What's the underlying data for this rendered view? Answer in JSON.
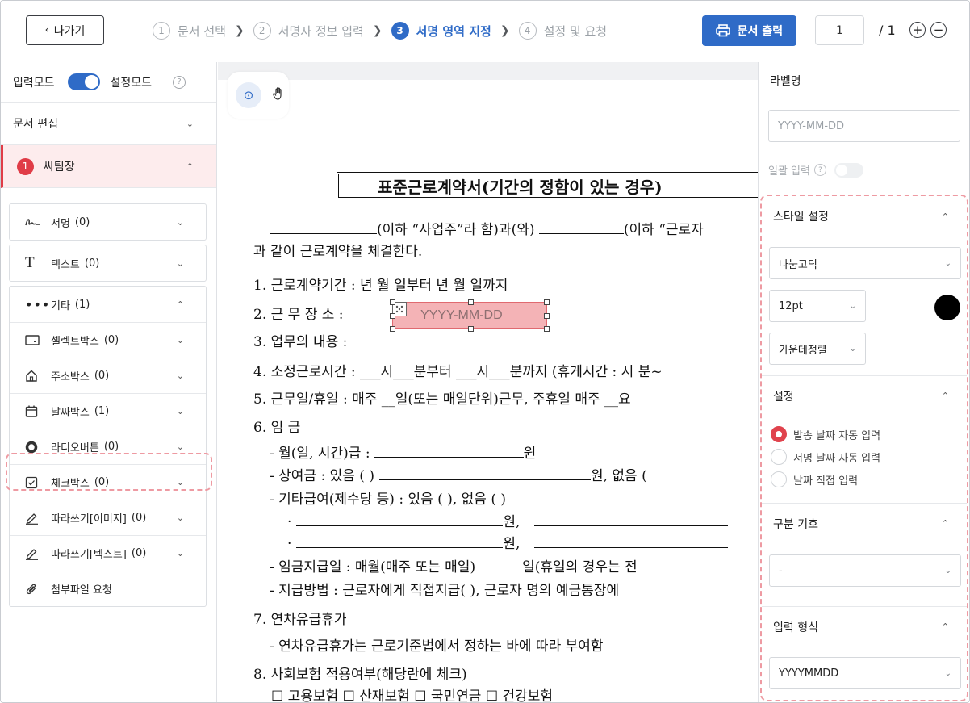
{
  "header": {
    "back_label": "나가기",
    "steps": [
      {
        "num": "1",
        "label": "문서 선택"
      },
      {
        "num": "2",
        "label": "서명자 정보 입력"
      },
      {
        "num": "3",
        "label": "서명 영역 지정",
        "active": true
      },
      {
        "num": "4",
        "label": "설정 및 요청"
      }
    ],
    "print_label": "문서 출력",
    "page_current": "1",
    "page_total": "/ 1"
  },
  "left": {
    "mode_input": "입력모드",
    "mode_setting": "설정모드",
    "help": "?",
    "doc_edit": "문서 편집",
    "participant_num": "1",
    "participant": "싸팀장",
    "fields": {
      "signature": {
        "label": "서명",
        "count": "(0)"
      },
      "text": {
        "label": "텍스트",
        "count": "(0)"
      },
      "other": {
        "label": "기타",
        "count": "(1)"
      },
      "items": [
        {
          "label": "셀렉트박스",
          "count": "(0)",
          "icon": "select-box-icon"
        },
        {
          "label": "주소박스",
          "count": "(0)",
          "icon": "home-icon"
        },
        {
          "label": "날짜박스",
          "count": "(1)",
          "icon": "calendar-icon"
        },
        {
          "label": "라디오버튼",
          "count": "(0)",
          "icon": "radio-icon"
        },
        {
          "label": "체크박스",
          "count": "(0)",
          "icon": "checkbox-icon"
        },
        {
          "label": "따라쓰기[이미지]",
          "count": "(0)",
          "icon": "pen-icon"
        },
        {
          "label": "따라쓰기[텍스트]",
          "count": "(0)",
          "icon": "pen-icon"
        },
        {
          "label": "첨부파일 요청",
          "count": "",
          "icon": "paperclip-icon"
        }
      ]
    }
  },
  "document": {
    "title": "표준근로계약서(기간의 정함이 있는 경우)",
    "lines": [
      "(이하 “사업주”라 함)과(와)",
      "(이하 “근로자",
      "과 같이 근로계약을 체결한다.",
      "1. 근로계약기간 :        년    월    일부터        년    월    일까지",
      "2. 근 무 장 소 :",
      "3. 업무의 내용 :",
      "4. 소정근로시간 : ___시___분부터 ___시___분까지 (휴게시간 :  시  분~",
      "5. 근무일/휴일 : 매주 __일(또는 매일단위)근무, 주휴일 매주 __요",
      "6. 임    금",
      "- 월(일, 시간)급 :",
      "원",
      "- 상여금 : 있음 (      )",
      "원,   없음 (",
      "- 기타급여(제수당 등) : 있음 (      ),     없음 (      )",
      "·",
      "원,",
      "·",
      "원,",
      "- 임금지급일 : 매월(매주 또는 매일)",
      "일(휴일의 경우는 전",
      "- 지급방법 : 근로자에게 직접지급(      ),   근로자 명의 예금통장에",
      "7. 연차유급휴가",
      "- 연차유급휴가는 근로기준법에서 정하는 바에 따라 부여함",
      "8. 사회보험 적용여부(해당란에 체크)",
      "☐ 고용보험  ☐ 산재보험  ☐ 국민연금  ☐ 건강보험"
    ],
    "date_field_placeholder": "YYYY-MM-DD"
  },
  "right": {
    "label_title": "라벨명",
    "label_placeholder": "YYYY-MM-DD",
    "bulk_input": "일괄 입력",
    "style_title": "스타일 설정",
    "font": "나눔고딕",
    "size": "12pt",
    "text_color": "#000000",
    "align": "가운데정렬",
    "settings_title": "설정",
    "radio_options": [
      {
        "label": "발송 날짜 자동 입력",
        "selected": true
      },
      {
        "label": "서명 날짜 자동 입력",
        "selected": false
      },
      {
        "label": "날짜 직접 입력",
        "selected": false
      }
    ],
    "separator_title": "구분 기호",
    "separator_value": "-",
    "format_title": "입력 형식",
    "format_value": "YYYYMMDD"
  }
}
